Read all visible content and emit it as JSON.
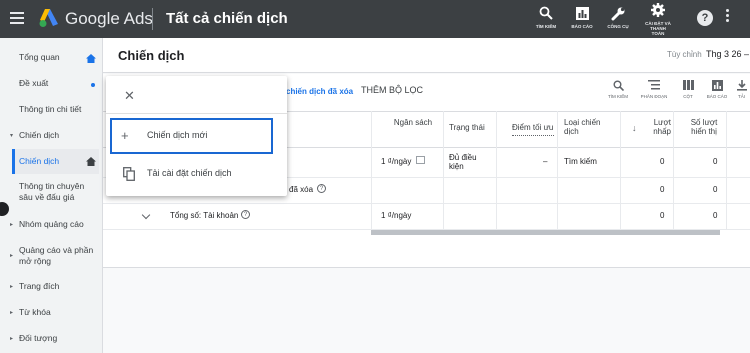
{
  "header": {
    "brand": "Google Ads",
    "title": "Tất cả chiến dịch",
    "tools": [
      {
        "label": "TÌM KIẾM",
        "icon": "search-icon"
      },
      {
        "label": "BÁO CÁO",
        "icon": "reports-icon"
      },
      {
        "label": "CÔNG CỤ",
        "icon": "wrench-icon"
      },
      {
        "label": "CÀI ĐẶT VÀ",
        "label2": "THANH",
        "label3": "TOÁN",
        "icon": "gear-icon"
      }
    ],
    "help": "?"
  },
  "sidebar": {
    "items": [
      {
        "label": "Tổng quan"
      },
      {
        "label": "Đề xuất"
      },
      {
        "label": "Thông tin chi tiết"
      },
      {
        "label": "Chiến dịch"
      },
      {
        "label": "Chiến dịch"
      },
      {
        "label": "Thông tin chuyên sâu về đấu giá"
      },
      {
        "label": "Nhóm quảng cáo"
      },
      {
        "label": "Quảng cáo và phần mở rộng"
      },
      {
        "label": "Trang đích"
      },
      {
        "label": "Từ khóa"
      },
      {
        "label": "Đối tượng"
      }
    ]
  },
  "main": {
    "page_title": "Chiến dịch",
    "custom_label": "Tùy chỉnh",
    "date_range": "Thg 3 26 –",
    "filter_link": "chiến dịch đã xóa",
    "more_filters": "THÊM BỘ LỌC",
    "toolbar": [
      {
        "label": "TÌM KIẾM",
        "icon": "search-icon"
      },
      {
        "label": "PHÂN ĐOẠN",
        "icon": "segment-icon"
      },
      {
        "label": "CỘT",
        "icon": "columns-icon"
      },
      {
        "label": "BÁO CÁO",
        "icon": "reports-icon"
      },
      {
        "label": "TẢI",
        "icon": "download-icon"
      }
    ]
  },
  "table": {
    "headers": {
      "budget": "Ngân sách",
      "status": "Trạng thái",
      "opt_score": "Điểm tối ưu",
      "campaign_type": "Loại chiến dịch",
      "clicks": "Lượt nhấp",
      "impressions": "Số lượt hiển thị"
    },
    "row1": {
      "budget": "1 ₫/ngày",
      "status": "Đủ điều kiện",
      "opt_score": "–",
      "type": "Tìm kiếm",
      "clicks": "0",
      "impressions": "0"
    },
    "row2": {
      "name": "đã xóa",
      "clicks": "0",
      "impressions": "0"
    },
    "row3": {
      "name": "Tổng số: Tài khoản",
      "budget": "1 ₫/ngày",
      "clicks": "0",
      "impressions": "0"
    }
  },
  "popup": {
    "new_campaign": "Chiến dịch mới",
    "load_settings": "Tải cài đặt chiến dịch"
  }
}
